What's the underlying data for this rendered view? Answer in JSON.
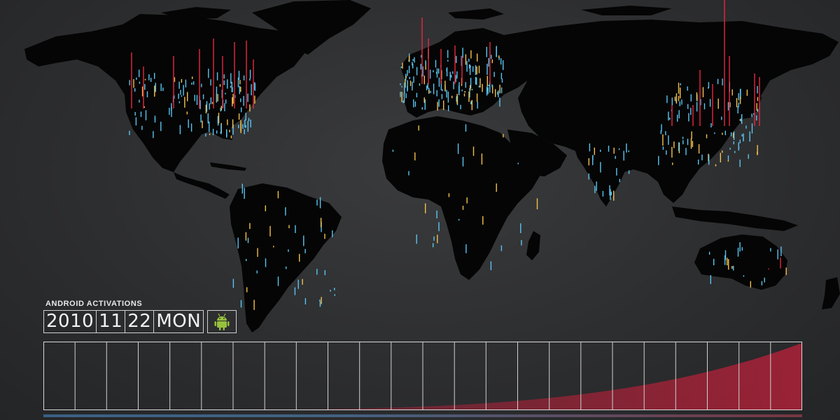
{
  "hud": {
    "title": "ANDROID ACTIVATIONS",
    "date": {
      "year": "2010",
      "month": "11",
      "day": "22",
      "weekday": "MON"
    },
    "icon": "android-robot-icon"
  },
  "timeline": {
    "segments": 24,
    "current_fraction": 1.0
  },
  "colors": {
    "background": "#2c2d2f",
    "land": "#050505",
    "spike_blue": "#5bc4ef",
    "spike_yellow": "#f2c14e",
    "spike_red": "#e0283f",
    "android_green": "#97c03d",
    "timeline_fill": "#c0203a"
  }
}
